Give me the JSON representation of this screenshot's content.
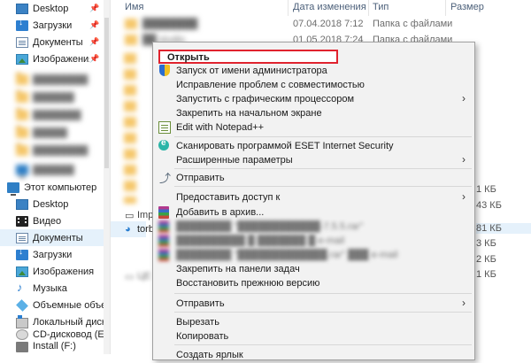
{
  "nav": {
    "quick_access": [
      {
        "label": "Desktop",
        "icon": "desktop-icon",
        "pinned": true
      },
      {
        "label": "Загрузки",
        "icon": "downloads-icon",
        "pinned": true
      },
      {
        "label": "Документы",
        "icon": "documents-icon",
        "pinned": true
      },
      {
        "label": "Изображения",
        "icon": "images-icon",
        "pinned": true
      }
    ],
    "this_pc": {
      "label": "Этот компьютер",
      "icon": "computer-icon"
    },
    "pc_items": [
      {
        "label": "Desktop",
        "icon": "desktop-icon"
      },
      {
        "label": "Видео",
        "icon": "video-icon"
      },
      {
        "label": "Документы",
        "icon": "documents-icon",
        "selected": true
      },
      {
        "label": "Загрузки",
        "icon": "downloads-icon"
      },
      {
        "label": "Изображения",
        "icon": "images-icon"
      },
      {
        "label": "Музыка",
        "icon": "music-icon"
      },
      {
        "label": "Объемные объекты",
        "icon": "3d-objects-icon"
      },
      {
        "label": "Локальный диск (C:",
        "icon": "local-disk-icon"
      },
      {
        "label": "CD-дисковод (E:)",
        "icon": "cd-drive-icon"
      },
      {
        "label": "Install (F:)",
        "icon": "usb-drive-icon"
      }
    ]
  },
  "columns": {
    "name": "Имя",
    "date": "Дата изменения",
    "type": "Тип",
    "size": "Размер"
  },
  "files": [
    {
      "date": "07.04.2018 7:12",
      "type": "Папка с файлами"
    },
    {
      "date": "01.05.2018 7:24",
      "type": "Папка с файлами"
    }
  ],
  "partial": {
    "file1": "Imp",
    "file2": "torb",
    "file3": "ЦЕ"
  },
  "sizes": [
    "1 КБ",
    "43 КБ",
    "81 КБ",
    "3 КБ",
    "2 КБ",
    "1 КБ"
  ],
  "context_menu": {
    "open": "Открыть",
    "run_as_admin": "Запуск от имени администратора",
    "compat": "Исправление проблем с совместимостью",
    "run_gpu": "Запустить с графическим процессором",
    "pin_start": "Закрепить на начальном экране",
    "notepad": "Edit with Notepad++",
    "eset": "Сканировать программой ESET Internet Security",
    "advanced": "Расширенные параметры",
    "send1": "Отправить",
    "share": "Предоставить доступ к",
    "add_archive": "Добавить в архив...",
    "pin_taskbar": "Закрепить на панели задач",
    "restore": "Восстановить прежнюю версию",
    "send2": "Отправить",
    "cut": "Вырезать",
    "copy": "Копировать",
    "create_shortcut": "Создать ярлык"
  }
}
